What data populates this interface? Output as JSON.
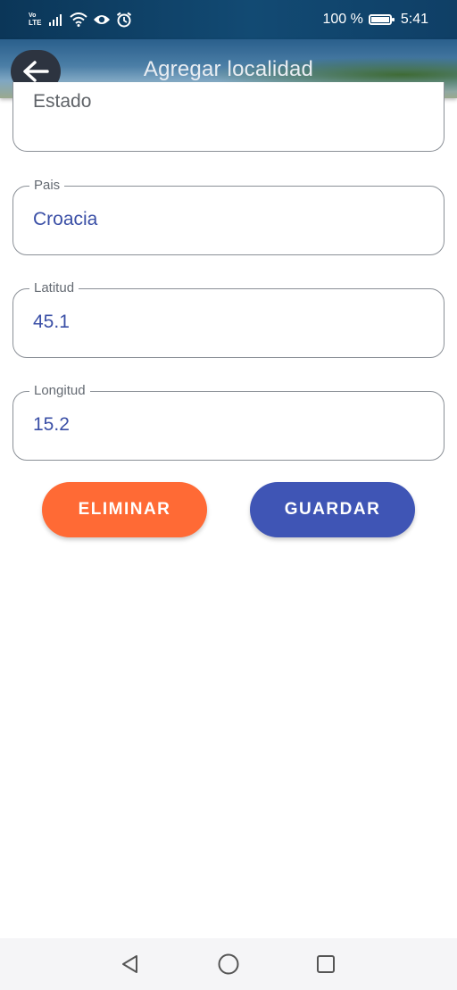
{
  "status_bar": {
    "network": "LTE",
    "battery": "100 %",
    "battery_level": 1.0,
    "time": "5:41"
  },
  "app_bar": {
    "title": "Agregar localidad",
    "back_icon": "arrow-left-icon"
  },
  "form": {
    "estado": {
      "placeholder": "Estado",
      "value": ""
    },
    "pais": {
      "label": "Pais",
      "value": "Croacia"
    },
    "latitud": {
      "label": "Latitud",
      "value": "45.1"
    },
    "longitud": {
      "label": "Longitud",
      "value": "15.2"
    }
  },
  "buttons": {
    "delete_label": "ELIMINAR",
    "save_label": "GUARDAR"
  },
  "colors": {
    "accent": "#3f55b5",
    "delete": "#ff6a35",
    "save": "#3f55b5",
    "value_text": "#3a4fa6"
  },
  "nav_bar": {
    "back_icon": "triangle-back-icon",
    "home_icon": "circle-home-icon",
    "recents_icon": "square-recents-icon"
  }
}
